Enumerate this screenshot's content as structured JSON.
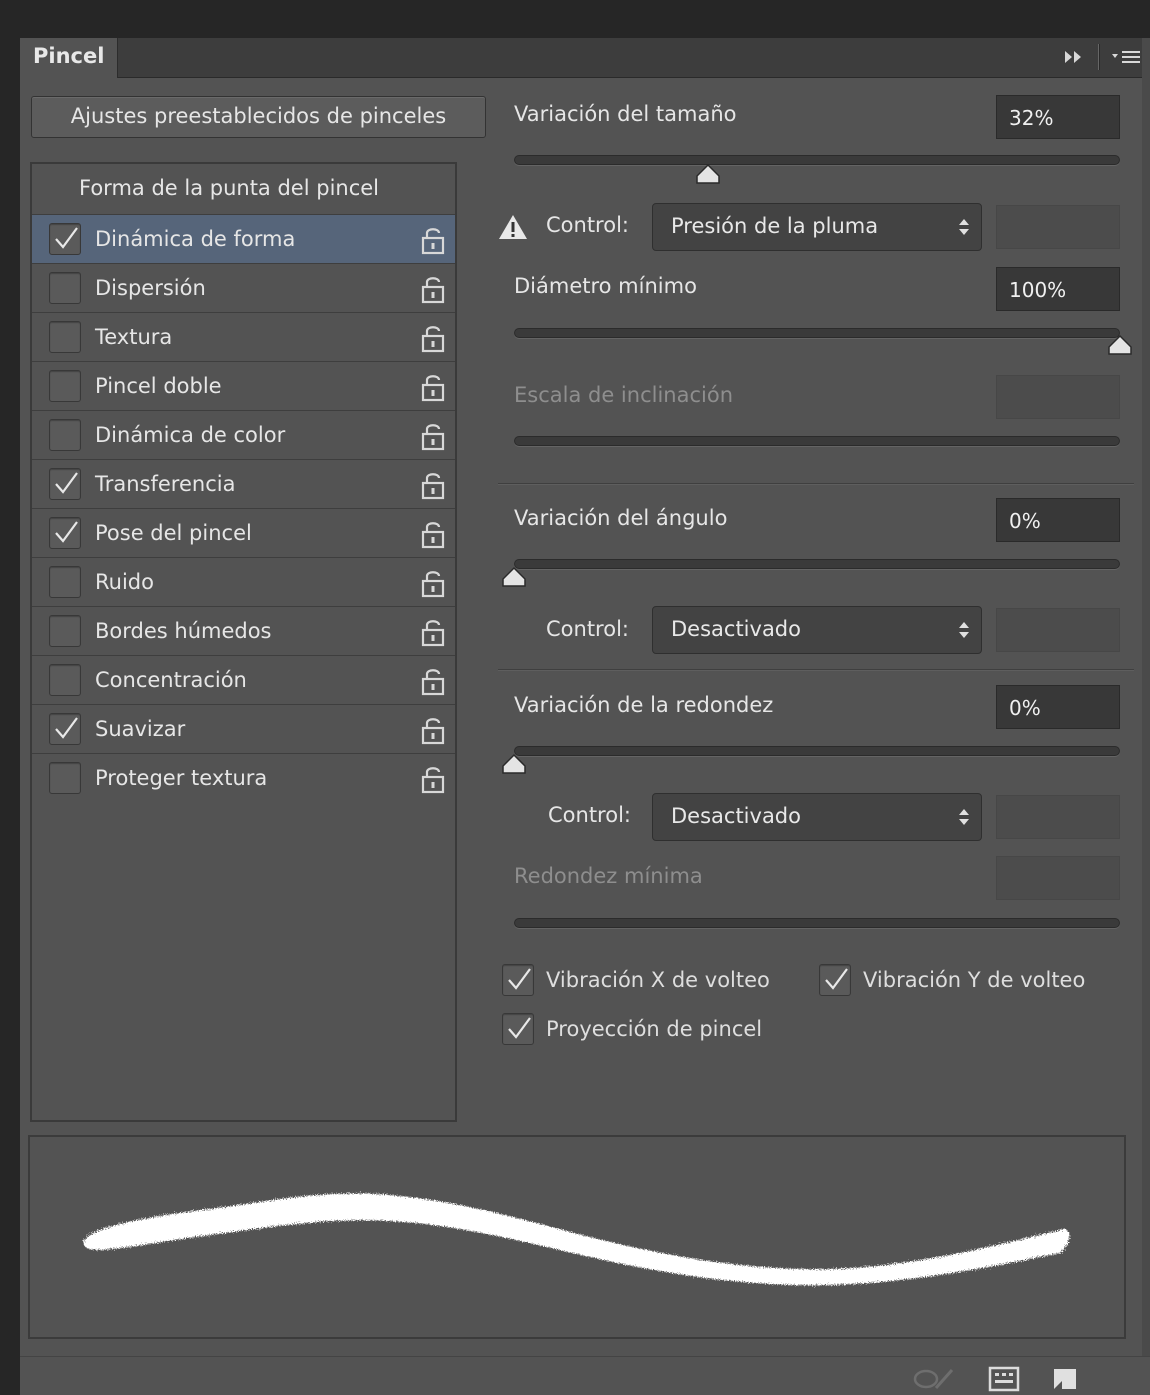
{
  "panel": {
    "tab_label": "Pincel",
    "presets_button": "Ajustes preestablecidos de pinceles"
  },
  "list": {
    "header": "Forma de la punta del pincel",
    "items": [
      {
        "label": "Dinámica de forma",
        "checked": true,
        "selected": true
      },
      {
        "label": "Dispersión",
        "checked": false,
        "selected": false
      },
      {
        "label": "Textura",
        "checked": false,
        "selected": false
      },
      {
        "label": "Pincel doble",
        "checked": false,
        "selected": false
      },
      {
        "label": "Dinámica de color",
        "checked": false,
        "selected": false
      },
      {
        "label": "Transferencia",
        "checked": true,
        "selected": false
      },
      {
        "label": "Pose del pincel",
        "checked": true,
        "selected": false
      },
      {
        "label": "Ruido",
        "checked": false,
        "selected": false
      },
      {
        "label": "Bordes húmedos",
        "checked": false,
        "selected": false
      },
      {
        "label": "Concentración",
        "checked": false,
        "selected": false
      },
      {
        "label": "Suavizar",
        "checked": true,
        "selected": false
      },
      {
        "label": "Proteger textura",
        "checked": false,
        "selected": false
      }
    ]
  },
  "settings": {
    "size_jitter": {
      "label": "Variación del tamaño",
      "value": "32%",
      "fraction": 0.32
    },
    "size_control": {
      "label": "Control:",
      "value": "Presión de la pluma"
    },
    "min_diameter": {
      "label": "Diámetro mínimo",
      "value": "100%",
      "fraction": 1.0
    },
    "tilt_scale": {
      "label": "Escala de inclinación"
    },
    "angle_jitter": {
      "label": "Variación del ángulo",
      "value": "0%",
      "fraction": 0.0
    },
    "angle_control": {
      "label": "Control:",
      "value": "Desactivado"
    },
    "roundness_jitter": {
      "label": "Variación de la redondez",
      "value": "0%",
      "fraction": 0.0
    },
    "roundness_control": {
      "label": "Control:",
      "value": "Desactivado"
    },
    "min_roundness": {
      "label": "Redondez mínima"
    },
    "flip_x": {
      "label": "Vibración X de volteo",
      "checked": true
    },
    "flip_y": {
      "label": "Vibración Y de volteo",
      "checked": true
    },
    "brush_projection": {
      "label": "Proyección de pincel",
      "checked": true
    }
  },
  "icons": {
    "warning": "warning-triangle-icon",
    "lock": "unlocked-padlock-icon",
    "checkmark": "checkmark-icon"
  },
  "colors": {
    "panel_bg": "#535353",
    "selected_row": "#56657a",
    "stroke": "#ffffff"
  }
}
